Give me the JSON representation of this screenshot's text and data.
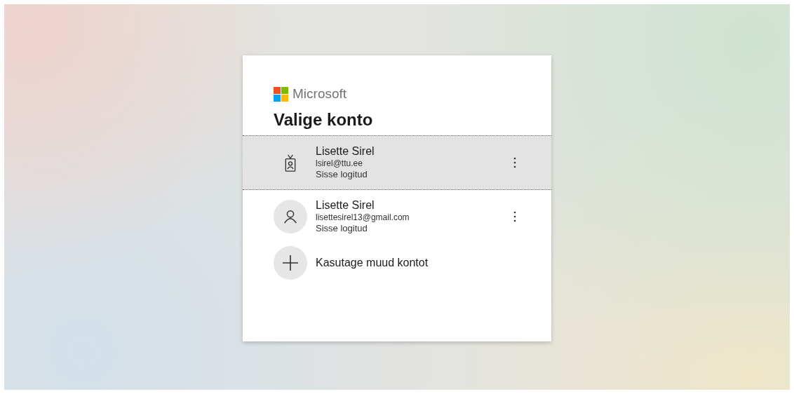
{
  "brand": {
    "name": "Microsoft"
  },
  "title": "Valige konto",
  "accounts": [
    {
      "kind": "work",
      "name": "Lisette Sirel",
      "email": "lsirel@ttu.ee",
      "status": "Sisse logitud",
      "selected": true
    },
    {
      "kind": "personal",
      "name": "Lisette Sirel",
      "email": "lisettesirel13@gmail.com",
      "status": "Sisse logitud",
      "selected": false
    }
  ],
  "add_account": {
    "label": "Kasutage muud kontot"
  }
}
